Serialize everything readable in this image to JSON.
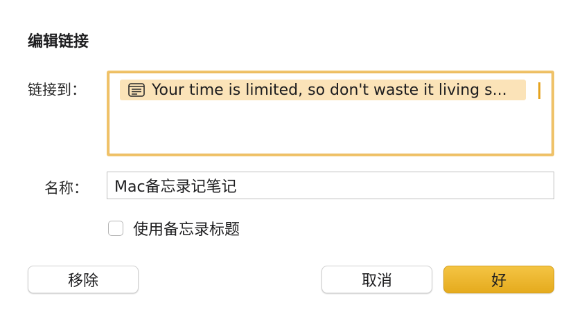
{
  "dialog": {
    "title": "编辑链接"
  },
  "link": {
    "label": "链接到：",
    "token_icon": "note-icon",
    "token_text": "Your time is limited, so don't waste it living s..."
  },
  "name": {
    "label": "名称：",
    "value": "Mac备忘录记笔记"
  },
  "use_note_title": {
    "label": "使用备忘录标题",
    "checked": false
  },
  "buttons": {
    "remove": "移除",
    "cancel": "取消",
    "ok": "好"
  },
  "colors": {
    "accent": "#e5ab1e",
    "focus_ring": "#f0c36a",
    "token_highlight": "#fbe3b8"
  }
}
